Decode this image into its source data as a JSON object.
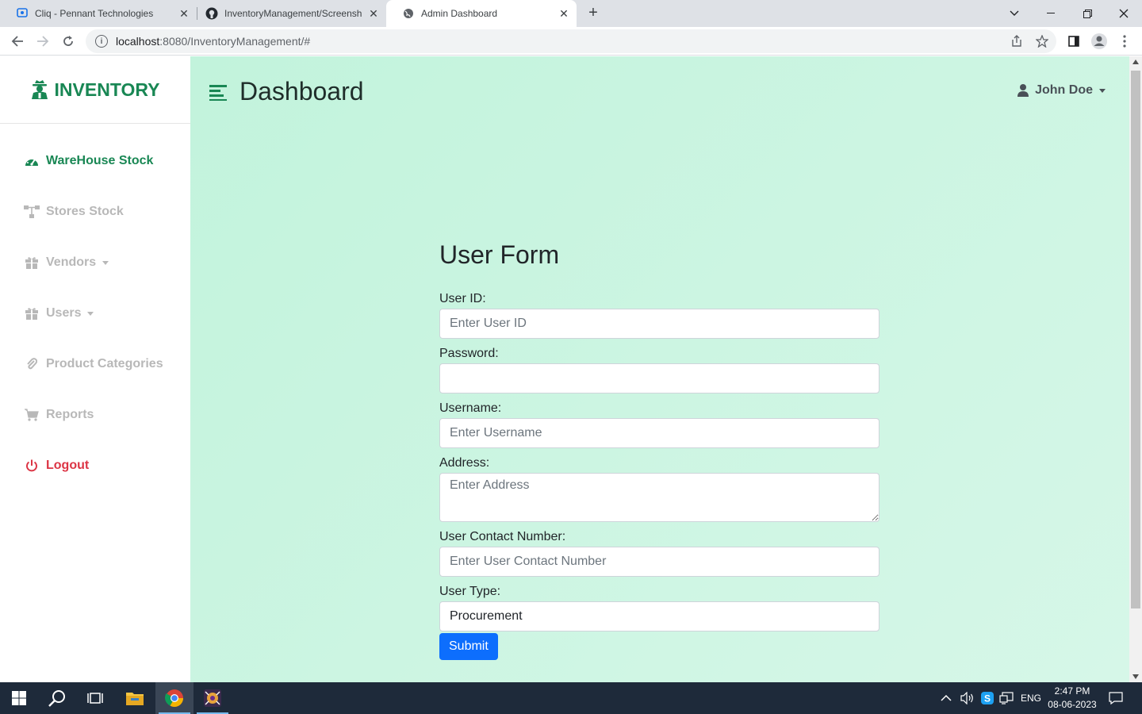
{
  "browser": {
    "tabs": [
      {
        "title": "Cliq - Pennant Technologies",
        "active": false
      },
      {
        "title": "InventoryManagement/Screensh",
        "active": false
      },
      {
        "title": "Admin Dashboard",
        "active": true
      }
    ],
    "url_host": "localhost",
    "url_path": ":8080/InventoryManagement/#"
  },
  "sidebar": {
    "brand": "INVENTORY",
    "items": [
      {
        "label": "WareHouse Stock",
        "icon": "tachometer-icon"
      },
      {
        "label": "Stores Stock",
        "icon": "sitemap-icon"
      },
      {
        "label": "Vendors",
        "icon": "gift-icon"
      },
      {
        "label": "Users",
        "icon": "gift-icon"
      },
      {
        "label": "Product Categories",
        "icon": "paperclip-icon"
      },
      {
        "label": "Reports",
        "icon": "cart-icon"
      },
      {
        "label": "Logout",
        "icon": "power-icon"
      }
    ]
  },
  "header": {
    "title": "Dashboard",
    "user": "John Doe"
  },
  "form": {
    "heading": "User Form",
    "user_id_label": "User ID:",
    "user_id_placeholder": "Enter User ID",
    "password_label": "Password:",
    "username_label": "Username:",
    "username_placeholder": "Enter Username",
    "address_label": "Address:",
    "address_placeholder": "Enter Address",
    "contact_label": "User Contact Number:",
    "contact_placeholder": "Enter User Contact Number",
    "user_type_label": "User Type:",
    "user_type_value": "Procurement",
    "submit_label": "Submit"
  },
  "taskbar": {
    "language": "ENG",
    "time": "2:47 PM",
    "date": "08-06-2023"
  },
  "colors": {
    "brand_green": "#198754",
    "logout_red": "#dc3545",
    "submit_blue": "#0d6efd"
  }
}
